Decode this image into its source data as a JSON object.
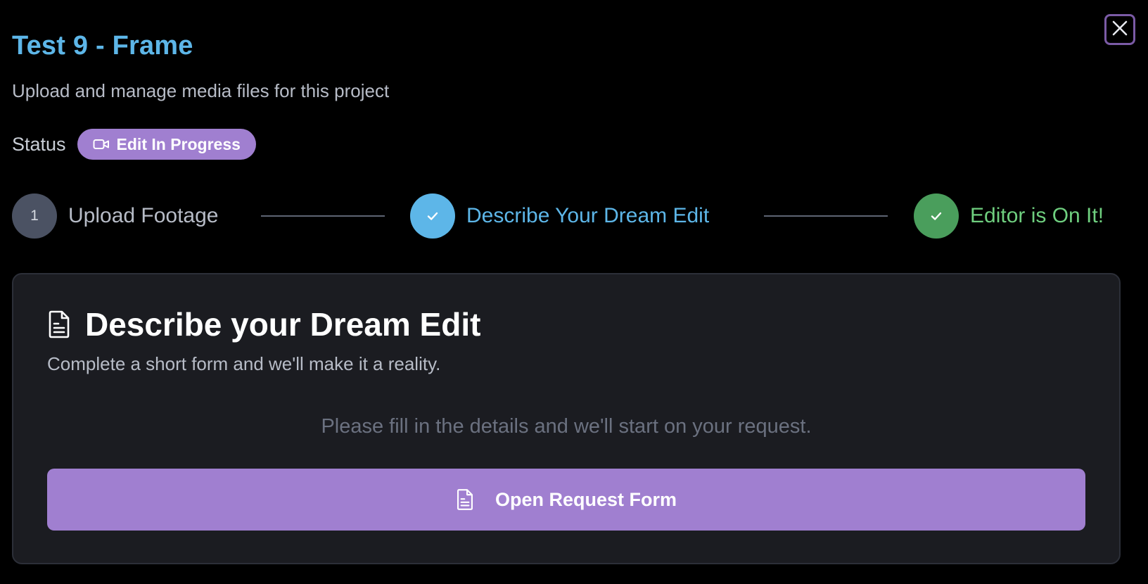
{
  "project": {
    "title": "Test 9 - Frame",
    "subtitle": "Upload and manage media files for this project"
  },
  "status": {
    "label": "Status",
    "badge_text": "Edit In Progress",
    "badge_icon": "video-camera-icon",
    "badge_color": "#a07fd0"
  },
  "stepper": {
    "steps": [
      {
        "marker": "1",
        "label": "Upload Footage",
        "state": "pending",
        "color": "#4b5263"
      },
      {
        "marker": "✓",
        "label": "Describe Your Dream Edit",
        "state": "complete",
        "color": "#5db6e8"
      },
      {
        "marker": "✓",
        "label": "Editor is On It!",
        "state": "complete",
        "color": "#4a9e5c"
      }
    ]
  },
  "card": {
    "title": "Describe your Dream Edit",
    "title_icon": "document-icon",
    "description": "Complete a short form and we'll make it a reality.",
    "hint": "Please fill in the details and we'll start on your request.",
    "button_label": "Open Request Form",
    "button_icon": "document-icon"
  },
  "close": {
    "icon": "close-icon"
  },
  "colors": {
    "title": "#5db6e8",
    "accent_purple": "#a07fd0",
    "success_green": "#6fcf7f",
    "card_background": "#1b1c21"
  }
}
